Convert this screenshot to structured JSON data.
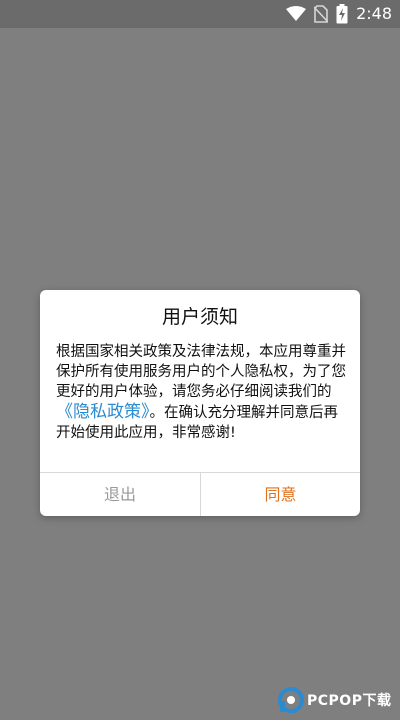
{
  "status_bar": {
    "time": "2:48",
    "icons": [
      "wifi-icon",
      "no-sim-icon",
      "battery-charging-icon"
    ]
  },
  "dialog": {
    "title": "用户须知",
    "body_before_link": "根据国家相关政策及法律法规，本应用尊重并保护所有使用服务用户的个人隐私权，为了您更好的用户体验，请您务必仔细阅读我们的",
    "policy_link": "《隐私政策》",
    "body_after_link": "。在确认充分理解并同意后再开始使用此应用，非常感谢!",
    "exit_label": "退出",
    "agree_label": "同意"
  },
  "watermark": {
    "text": "PCPOP下载"
  },
  "colors": {
    "background": "#7f7f7f",
    "link": "#2a8bd0",
    "agree": "#e0711c",
    "exit": "#9a9a9a"
  }
}
